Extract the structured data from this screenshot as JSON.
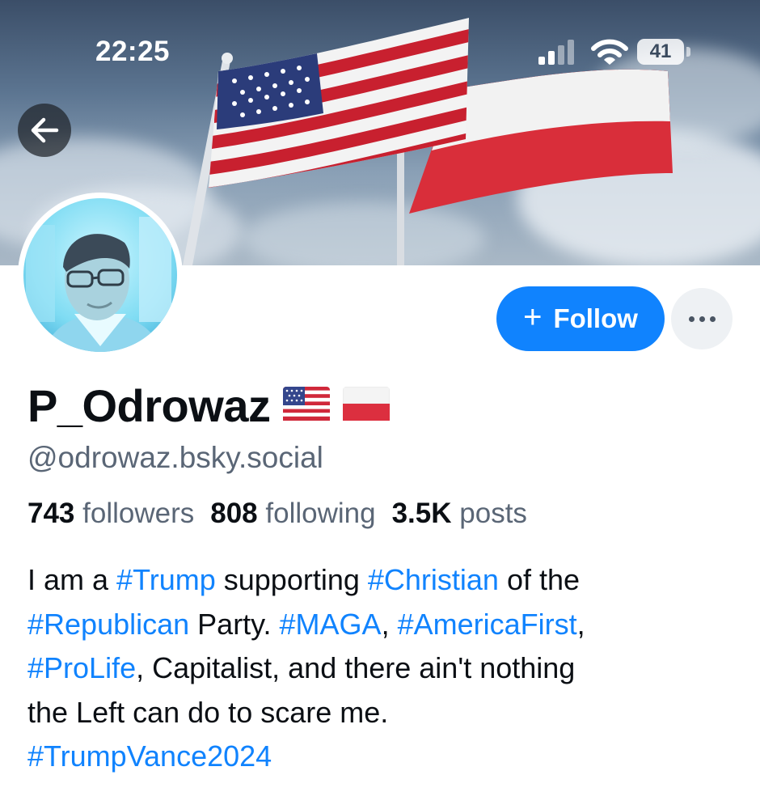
{
  "status_bar": {
    "time": "22:25",
    "battery": "41",
    "icons": [
      "cellular-signal-icon",
      "wifi-icon",
      "battery-icon"
    ]
  },
  "header": {
    "back_icon": "arrow-left-icon",
    "banner_image": "american-and-polish-flags"
  },
  "profile": {
    "display_name": "P_Odrowaz",
    "name_flags": [
      "united-states-flag",
      "poland-flag"
    ],
    "handle": "@odrowaz.bsky.social",
    "stats": {
      "followers_count": "743",
      "followers_label": "followers",
      "following_count": "808",
      "following_label": "following",
      "posts_count": "3.5K",
      "posts_label": "posts"
    },
    "bio": {
      "line1": {
        "t1": "I am a ",
        "tag1": "#Trump",
        "t2": " supporting ",
        "tag2": "#Christian",
        "t3": " of the"
      },
      "line2": {
        "tag1": "#Republican",
        "t1": " Party. ",
        "tag2": "#MAGA",
        "t2": ", ",
        "tag3": "#AmericaFirst",
        "t3": ","
      },
      "line3": {
        "tag1": "#ProLife",
        "t1": ", Capitalist, and there ain't nothing"
      },
      "line4": {
        "t1": "the Left can do to scare me."
      },
      "line5": {
        "tag1": "#TrumpVance2024"
      }
    }
  },
  "actions": {
    "follow_icon": "+",
    "follow_label": "Follow",
    "more_icon": "ellipsis-icon"
  },
  "colors": {
    "accent": "#1083fe",
    "text_primary": "#0b0f14",
    "text_secondary": "#5a6676",
    "more_button_bg": "#eef1f4"
  }
}
